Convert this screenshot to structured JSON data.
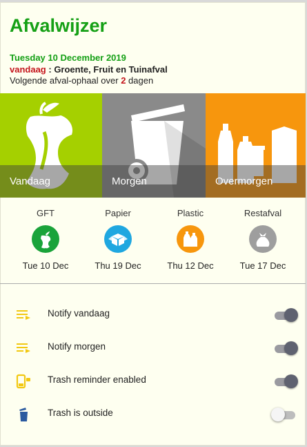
{
  "header": {
    "title": "Afvalwijzer",
    "date": "Tuesday 10 December 2019",
    "today_prefix": "vandaag",
    "today_sep": " : ",
    "today_value": "Groente, Fruit en Tuinafval",
    "next_prefix": "Volgende afval-ophaal over ",
    "next_days": "2",
    "next_suffix": " dagen"
  },
  "tiles": [
    {
      "label": "Vandaag",
      "icon": "apple-core-icon",
      "color": "#a5d000"
    },
    {
      "label": "Morgen",
      "icon": "paper-bin-icon",
      "color": "#8a8a8a"
    },
    {
      "label": "Overmorgen",
      "icon": "bottles-cans-icon",
      "color": "#f7960d"
    }
  ],
  "schedule": [
    {
      "name": "GFT",
      "date": "Tue 10 Dec",
      "color": "#1aa33a",
      "icon": "apple-icon"
    },
    {
      "name": "Papier",
      "date": "Thu 19 Dec",
      "color": "#1fa7e0",
      "icon": "box-icon"
    },
    {
      "name": "Plastic",
      "date": "Thu 12 Dec",
      "color": "#f7960d",
      "icon": "bottles-icon"
    },
    {
      "name": "Restafval",
      "date": "Tue 17 Dec",
      "color": "#9e9e9e",
      "icon": "trash-bag-icon"
    }
  ],
  "settings": [
    {
      "label": "Notify vandaag",
      "on": true,
      "icon": "notify-list-icon"
    },
    {
      "label": "Notify morgen",
      "on": true,
      "icon": "notify-list-icon"
    },
    {
      "label": "Trash reminder enabled",
      "on": true,
      "icon": "phone-reminder-icon"
    },
    {
      "label": "Trash is outside",
      "on": false,
      "icon": "trash-can-icon"
    }
  ],
  "colors": {
    "accent": "#15a015",
    "highlight": "#c4151c",
    "icon_yellow": "#f2c811",
    "icon_blue": "#2b5aa0"
  }
}
